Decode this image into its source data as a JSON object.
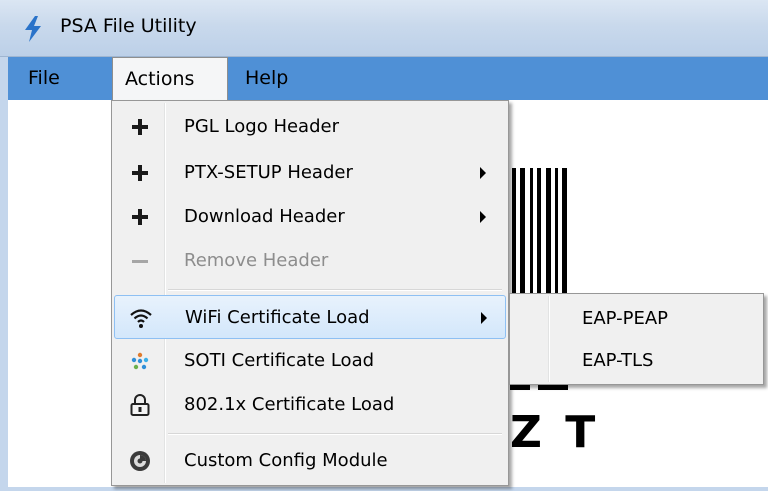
{
  "window": {
    "title": "PSA File Utility",
    "app_icon": "lightning-icon"
  },
  "menubar": {
    "items": [
      {
        "label": "File"
      },
      {
        "label": "Actions"
      },
      {
        "label": "Help"
      }
    ]
  },
  "background": {
    "text": "Z T"
  },
  "actions_menu": {
    "items": [
      {
        "label": "PGL Logo Header",
        "icon": "plus-icon"
      },
      {
        "label": "PTX-SETUP Header",
        "icon": "plus-icon",
        "submenu": true
      },
      {
        "label": "Download Header",
        "icon": "plus-icon",
        "submenu": true
      },
      {
        "label": "Remove Header",
        "icon": "minus-icon",
        "disabled": true
      },
      {
        "label": "WiFi Certificate Load",
        "icon": "wifi-icon",
        "submenu": true,
        "highlighted": true
      },
      {
        "label": "SOTI Certificate Load",
        "icon": "soti-icon"
      },
      {
        "label": "802.1x Certificate Load",
        "icon": "lock-icon"
      },
      {
        "label": "Custom Config Module",
        "icon": "config-icon"
      }
    ]
  },
  "wifi_submenu": {
    "items": [
      {
        "label": "EAP-PEAP"
      },
      {
        "label": "EAP-TLS"
      }
    ]
  },
  "colors": {
    "menubar": "#4f90d6",
    "highlight_border": "#8ec0f3",
    "disabled_text": "#8d8d8d"
  }
}
